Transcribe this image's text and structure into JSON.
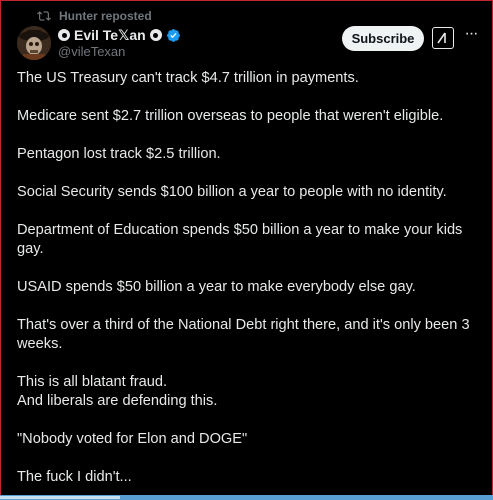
{
  "repost": {
    "text": "Hunter reposted"
  },
  "author": {
    "display_name": "Evil Te𝕏an",
    "handle": "@vileTexan"
  },
  "actions": {
    "subscribe_label": "Subscribe"
  },
  "post": {
    "paragraphs": [
      "The US Treasury can't track $4.7 trillion in payments.",
      "Medicare sent $2.7 trillion overseas to people that weren't eligible.",
      "Pentagon lost track $2.5 trillion.",
      "Social Security sends $100 billion a year to people with no identity.",
      "Department of Education spends $50 billion a year to make your kids gay.",
      "USAID spends $50 billion a year to make everybody else gay.",
      "That's over a third of the National Debt right there, and it's only been 3 weeks.",
      "This is all blatant fraud.",
      "And liberals are defending this.",
      "\"Nobody voted for Elon and DOGE\"",
      "The fuck I didn't..."
    ]
  },
  "colors": {
    "background": "#000000",
    "text": "#e7e9ea",
    "muted": "#71767b",
    "verified": "#1d9bf0",
    "frame": "#c0262b"
  }
}
